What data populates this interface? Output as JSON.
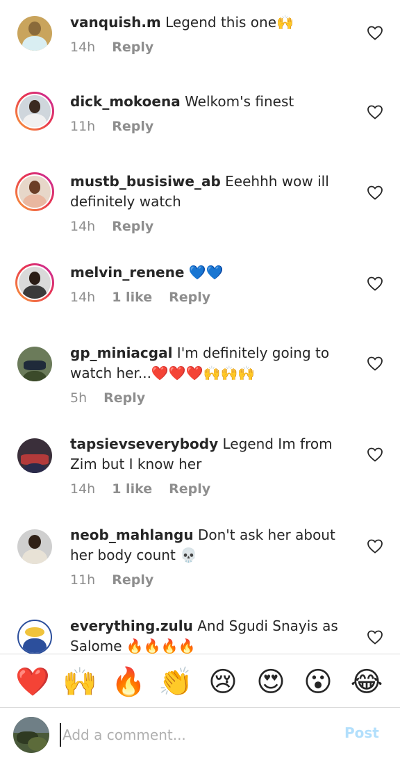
{
  "comments": [
    {
      "username": "vanquish.m",
      "text": " Legend this one🙌",
      "time": "14h",
      "likes": "",
      "reply": "Reply"
    },
    {
      "username": "dick_mokoena",
      "text": " Welkom's finest",
      "time": "11h",
      "likes": "",
      "reply": "Reply"
    },
    {
      "username": "mustb_busisiwe_ab",
      "text": " Eeehhh wow ill definitely watch",
      "time": "14h",
      "likes": "",
      "reply": "Reply"
    },
    {
      "username": "melvin_renene",
      "text": " 💙💙",
      "time": "14h",
      "likes": "1 like",
      "reply": "Reply"
    },
    {
      "username": "gp_miniacgal",
      "text": " I'm definitely going to watch her...❤️❤️❤️🙌🙌🙌",
      "time": "5h",
      "likes": "",
      "reply": "Reply"
    },
    {
      "username": "tapsievseverybody",
      "text": " Legend Im from Zim but I know her",
      "time": "14h",
      "likes": "1 like",
      "reply": "Reply"
    },
    {
      "username": "neob_mahlangu",
      "text": " Don't ask her about her body count 💀",
      "time": "11h",
      "likes": "",
      "reply": "Reply"
    },
    {
      "username": "everything.zulu",
      "text": " And Sgudi Snayis as Salome 🔥🔥🔥🔥",
      "time": "",
      "likes": "",
      "reply": ""
    }
  ],
  "quick_reactions": [
    "❤️",
    "🙌",
    "🔥",
    "👏",
    "😢",
    "😍",
    "😮",
    "😂"
  ],
  "composer": {
    "placeholder": "Add a comment...",
    "post_label": "Post"
  },
  "colors": {
    "post_disabled": "#b2dffc",
    "meta_gray": "#8e8e8e",
    "story_ring": "#e8344f"
  }
}
